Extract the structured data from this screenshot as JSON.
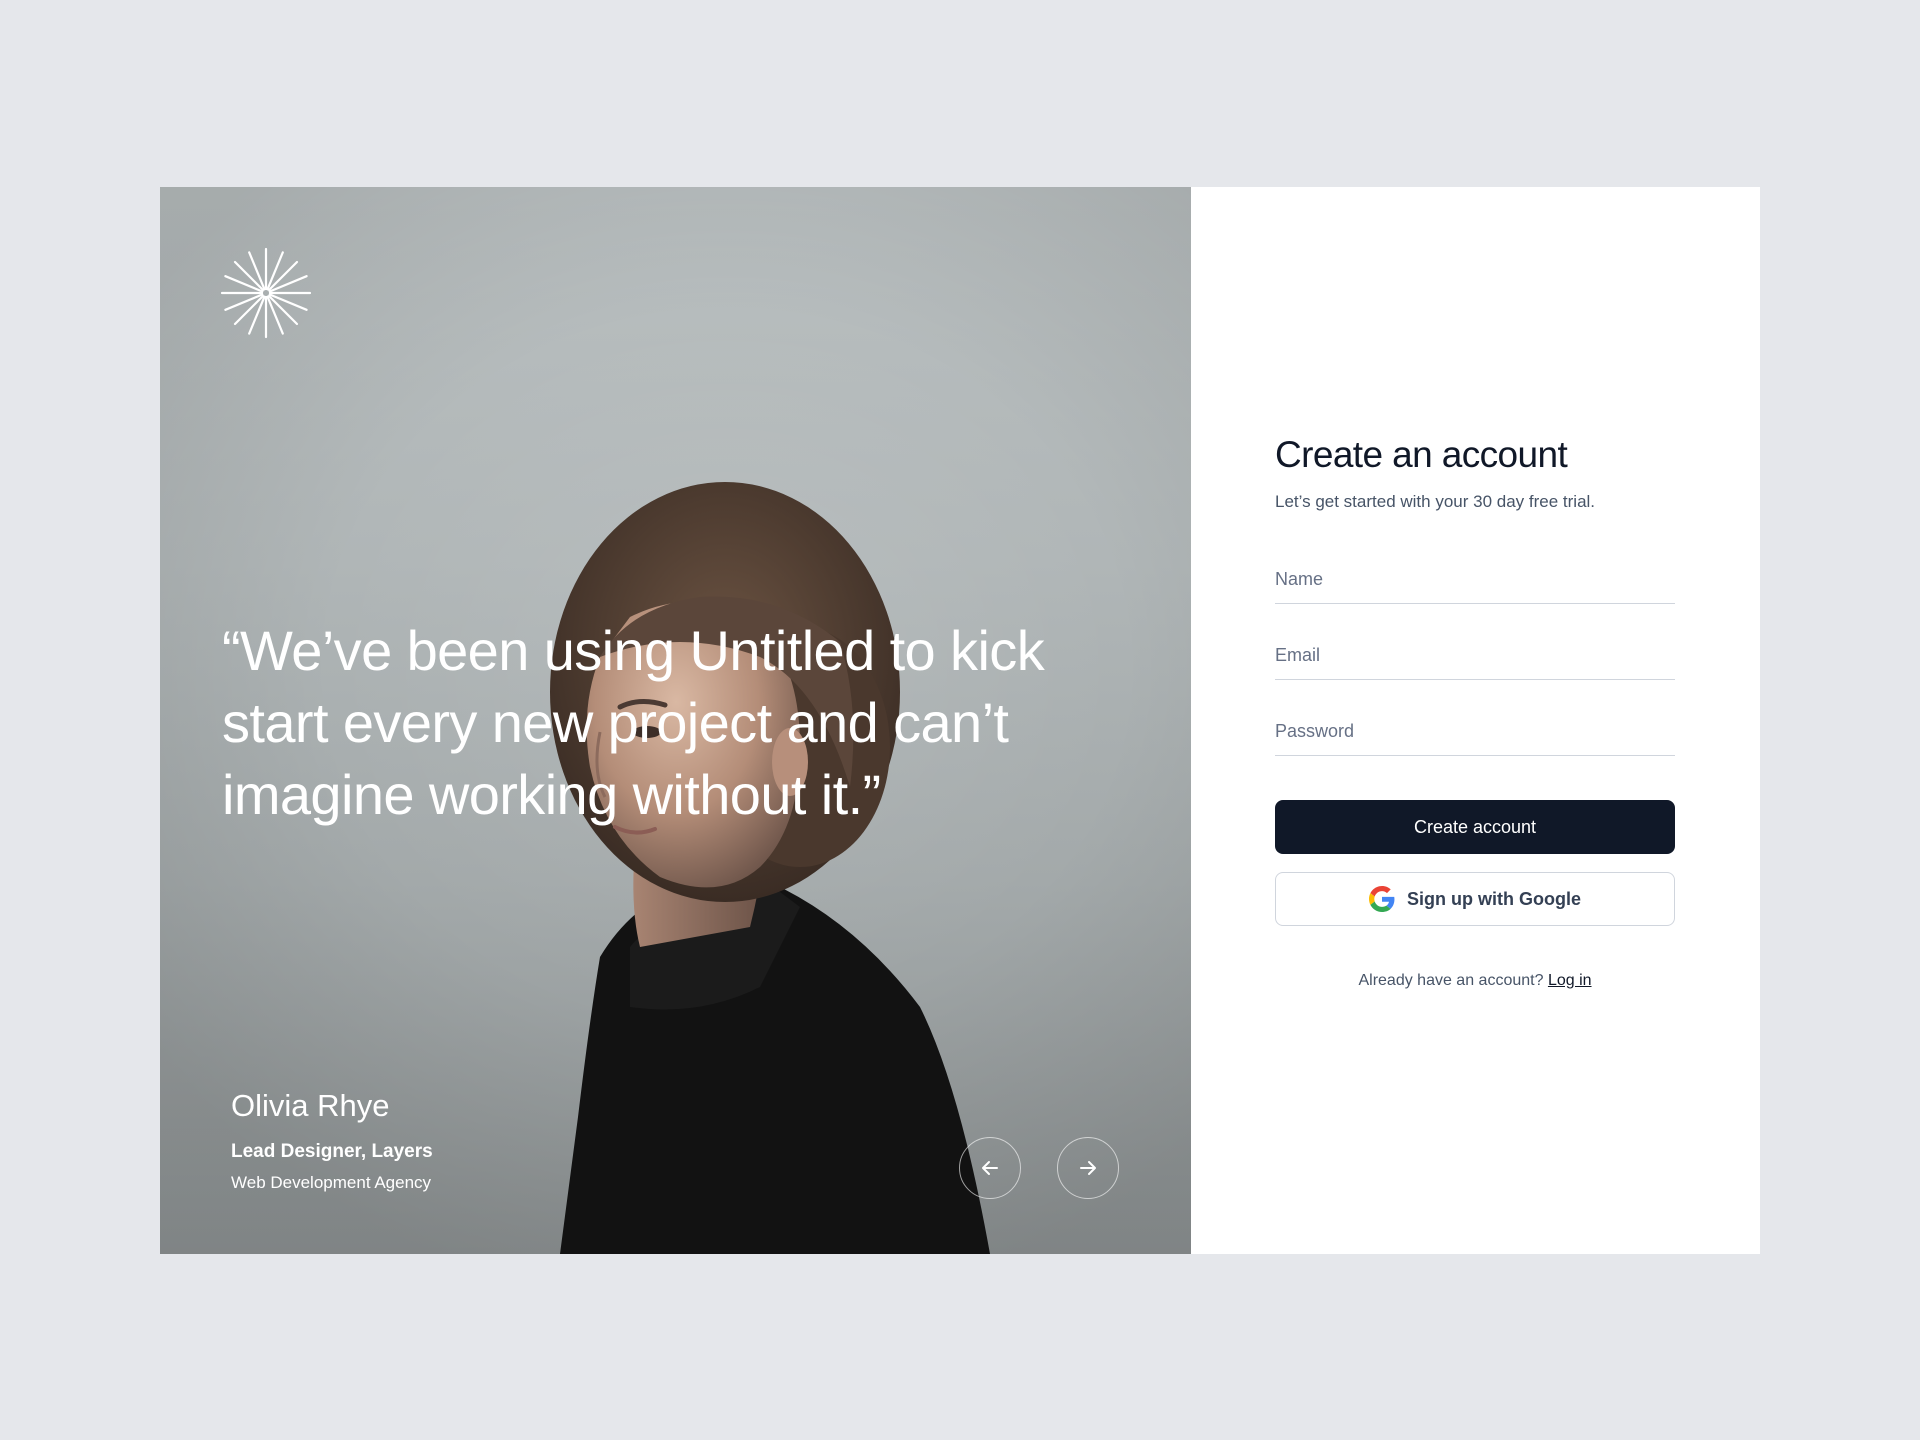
{
  "hero": {
    "quote": "“We’ve been using Untitled to kick start every new project and can’t imagine working without it.”",
    "author_name": "Olivia Rhye",
    "author_role": "Lead Designer, Layers",
    "author_org": "Web Development Agency",
    "logo_icon": "starburst-logo-icon",
    "prev_icon": "arrow-left-icon",
    "next_icon": "arrow-right-icon"
  },
  "form": {
    "title": "Create an account",
    "subtitle": "Let’s get started with your 30 day free trial.",
    "name_placeholder": "Name",
    "email_placeholder": "Email",
    "password_placeholder": "Password",
    "create_button": "Create account",
    "google_button": "Sign up with Google",
    "login_prompt": "Already have an account?",
    "login_link": "Log in"
  },
  "colors": {
    "primary": "#101828",
    "background": "#e5e7eb",
    "border": "#d0d5dd",
    "muted_text": "#475467"
  }
}
